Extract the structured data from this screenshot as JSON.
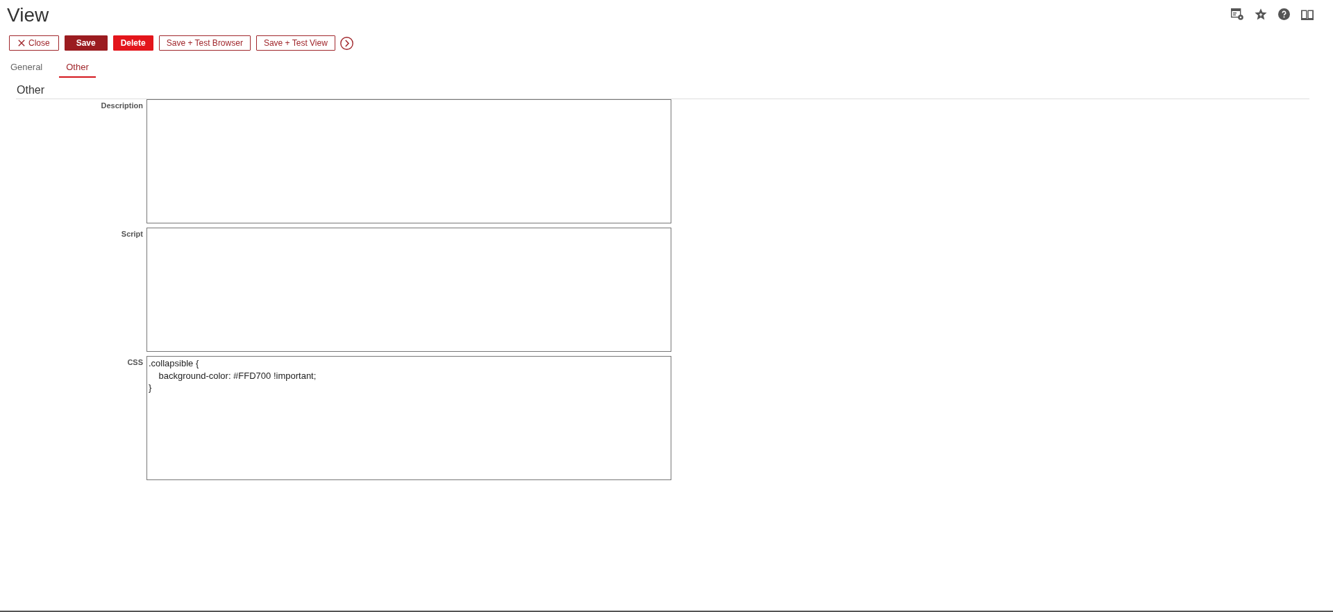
{
  "page": {
    "title": "View"
  },
  "toolbar": {
    "buttons": [
      {
        "label": "Close",
        "kind": "dismiss"
      },
      {
        "label": "Save",
        "kind": "filled"
      },
      {
        "label": "Delete",
        "kind": "danger"
      },
      {
        "label": "Save + Test Browser",
        "kind": "outline"
      },
      {
        "label": "Save + Test View",
        "kind": "outline"
      }
    ]
  },
  "tabs": [
    {
      "label": "General",
      "selected": false
    },
    {
      "label": "Other",
      "selected": true
    }
  ],
  "section": {
    "title": "Other",
    "fields": [
      {
        "label": "Description"
      },
      {
        "label": "Script"
      },
      {
        "label": "CSS",
        "value": ".collapsible {\n    background-color: #FFD700 !important;\n}"
      }
    ]
  }
}
